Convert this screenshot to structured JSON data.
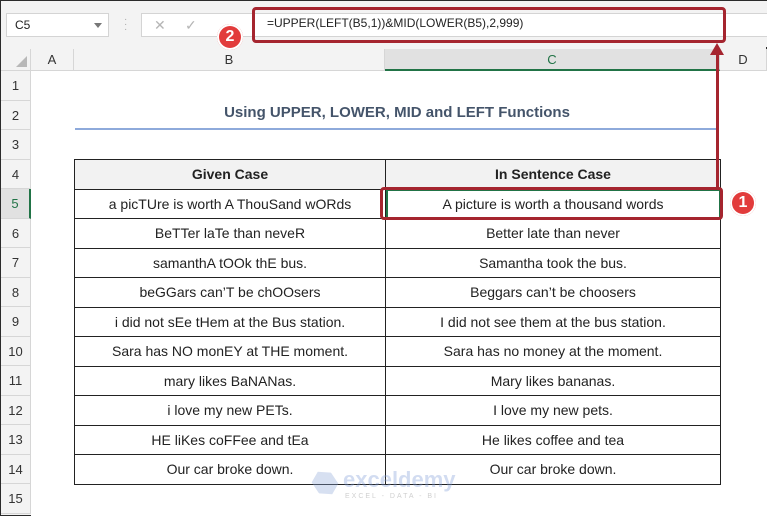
{
  "name_box": {
    "value": "C5"
  },
  "formula_bar": {
    "cancel_icon": "✕",
    "enter_icon": "✓",
    "formula": "=UPPER(LEFT(B5,1))&MID(LOWER(B5),2,999)"
  },
  "columns": [
    "A",
    "B",
    "C",
    "D"
  ],
  "selected_column": "C",
  "rows": [
    "1",
    "2",
    "3",
    "4",
    "5",
    "6",
    "7",
    "8",
    "9",
    "10",
    "11",
    "12",
    "13",
    "14",
    "15"
  ],
  "selected_row": "5",
  "sheet": {
    "title": "Using UPPER, LOWER, MID and LEFT Functions",
    "table": {
      "headers": [
        "Given Case",
        "In Sentence Case"
      ],
      "rows": [
        [
          "a picTUre is worth A ThouSand wORds",
          "A picture is worth a thousand words"
        ],
        [
          "BeTTer laTe than neveR",
          "Better late than never"
        ],
        [
          "samanthA tOOk thE bus.",
          "Samantha took the bus."
        ],
        [
          "beGGars can’T be chOOsers",
          "Beggars can’t be choosers"
        ],
        [
          "i did not sEe tHem at the Bus station.",
          "I did not see them at the bus station."
        ],
        [
          "Sara has NO monEY at THE moment.",
          "Sara has no money at the moment."
        ],
        [
          "mary likes BaNANas.",
          "Mary likes bananas."
        ],
        [
          "i love my new PETs.",
          "I love my new pets."
        ],
        [
          "HE liKes coFFee and tEa",
          "He likes coffee and tea"
        ],
        [
          "Our car broke down.",
          "Our car broke down."
        ]
      ]
    }
  },
  "annotations": {
    "badge_1": "1",
    "badge_2": "2"
  },
  "watermark": {
    "name": "exceldemy",
    "tagline": "EXCEL - DATA - BI"
  },
  "colors": {
    "highlight": "#a5252f",
    "badge": "#e23b3b",
    "excel_green": "#217346",
    "title": "#44546a"
  }
}
